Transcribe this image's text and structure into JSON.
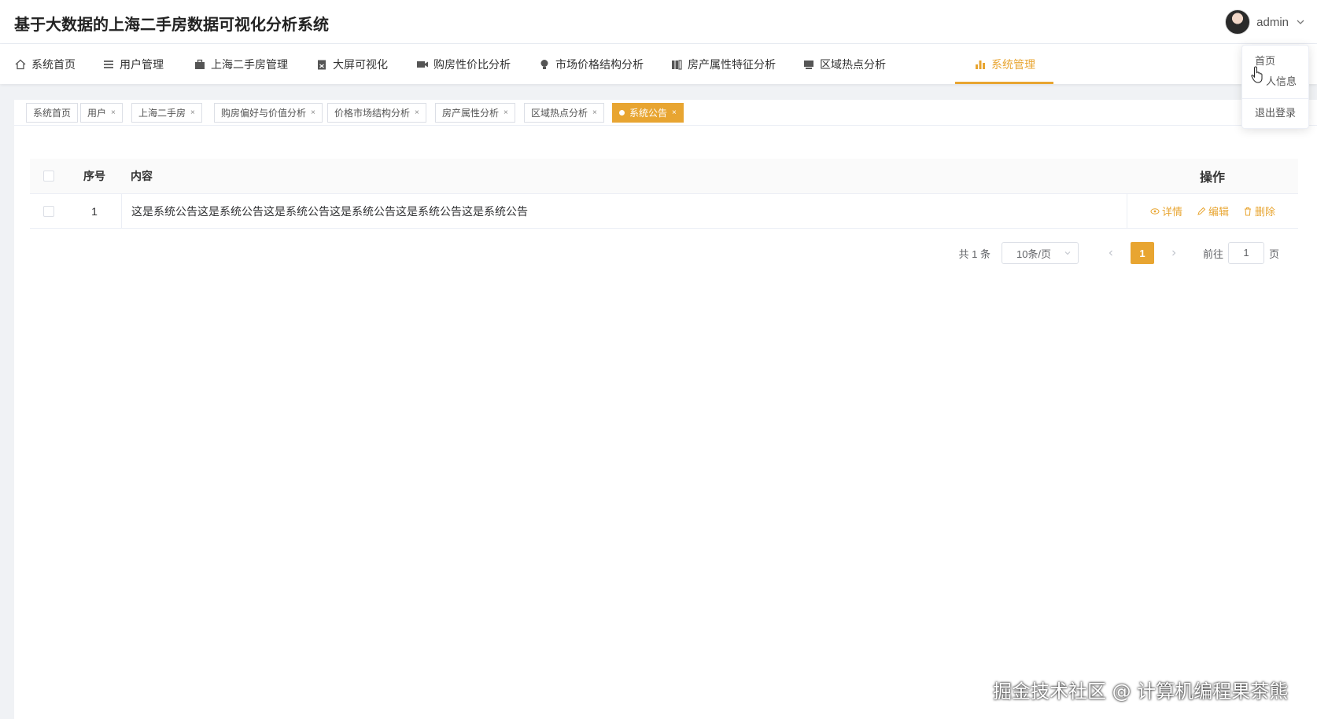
{
  "header": {
    "title": "基于大数据的上海二手房数据可视化分析系统",
    "username": "admin"
  },
  "nav": {
    "items": [
      {
        "label": "系统首页",
        "icon": "home-icon"
      },
      {
        "label": "用户管理",
        "icon": "menu-icon"
      },
      {
        "label": "上海二手房管理",
        "icon": "briefcase-icon"
      },
      {
        "label": "大屏可视化",
        "icon": "clipboard-icon"
      },
      {
        "label": "购房性价比分析",
        "icon": "camera-icon"
      },
      {
        "label": "市场价格结构分析",
        "icon": "bulb-icon"
      },
      {
        "label": "房产属性特征分析",
        "icon": "columns-icon"
      },
      {
        "label": "区域热点分析",
        "icon": "monitor-icon"
      },
      {
        "label": "系统管理",
        "icon": "bar-chart-icon"
      }
    ],
    "active_index": 8
  },
  "tabs": [
    {
      "label": "系统首页",
      "closable": false
    },
    {
      "label": "用户",
      "closable": true
    },
    {
      "label": "上海二手房",
      "closable": true
    },
    {
      "label": "购房偏好与价值分析",
      "closable": true
    },
    {
      "label": "价格市场结构分析",
      "closable": true
    },
    {
      "label": "房产属性分析",
      "closable": true
    },
    {
      "label": "区域热点分析",
      "closable": true
    },
    {
      "label": "系统公告",
      "closable": true,
      "active": true
    }
  ],
  "tab_close_symbol": "×",
  "table": {
    "headers": {
      "index": "序号",
      "content": "内容",
      "ops": "操作"
    },
    "rows": [
      {
        "index": "1",
        "content": "这是系统公告这是系统公告这是系统公告这是系统公告这是系统公告这是系统公告"
      }
    ],
    "ops": {
      "detail": "详情",
      "edit": "编辑",
      "delete": "删除"
    }
  },
  "pagination": {
    "total": "共 1 条",
    "page_size": "10条/页",
    "current_page": "1",
    "goto_label": "前往",
    "goto_value": "1",
    "page_unit": "页"
  },
  "dropdown": {
    "items": [
      "首页",
      "人信息",
      "退出登录"
    ]
  },
  "watermark": "掘金技术社区 @ 计算机编程果茶熊",
  "colors": {
    "accent": "#e8a531",
    "border": "#ebeef5",
    "bg": "#f0f2f5"
  }
}
